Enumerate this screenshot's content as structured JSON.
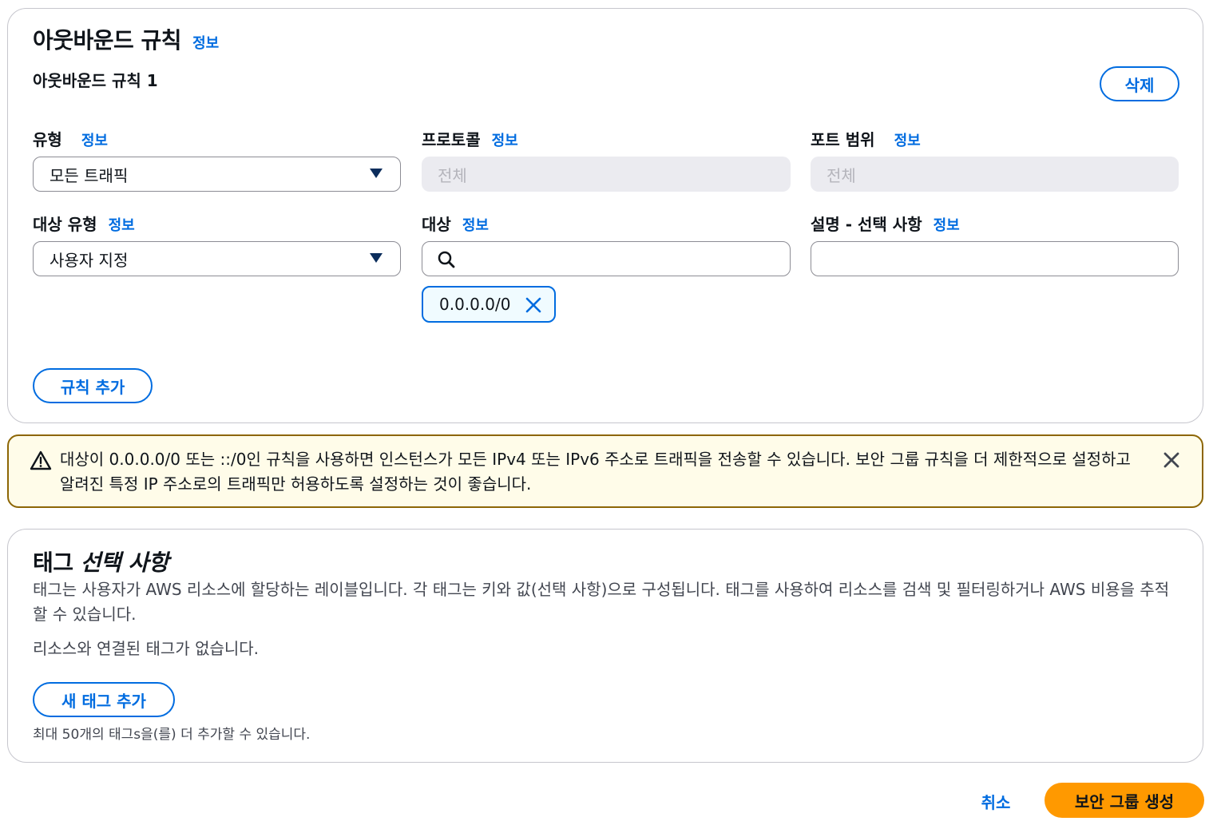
{
  "outbound": {
    "title": "아웃바운드 규칙",
    "info": "정보",
    "rule_title": "아웃바운드 규칙 1",
    "delete_label": "삭제",
    "type": {
      "label": "유형",
      "info": "정보",
      "value": "모든 트래픽"
    },
    "protocol": {
      "label": "프로토콜",
      "info": "정보",
      "value": "전체"
    },
    "port_range": {
      "label": "포트 범위",
      "info": "정보",
      "value": "전체"
    },
    "dest_type": {
      "label": "대상 유형",
      "info": "정보",
      "value": "사용자 지정"
    },
    "destination": {
      "label": "대상",
      "info": "정보",
      "value": "",
      "token": "0.0.0.0/0"
    },
    "description": {
      "label": "설명 - 선택 사항",
      "info": "정보",
      "value": ""
    },
    "add_rule_label": "규칙 추가"
  },
  "alert": {
    "text": "대상이 0.0.0.0/0 또는 ::/0인 규칙을 사용하면 인스턴스가 모든 IPv4 또는 IPv6 주소로 트래픽을 전송할 수 있습니다. 보안 그룹 규칙을 더 제한적으로 설정하고 알려진 특정 IP 주소로의 트래픽만 허용하도록 설정하는 것이 좋습니다.",
    "icon": "warning-icon"
  },
  "tags": {
    "title_plain": "태그",
    "title_italic": "선택 사항",
    "description": "태그는 사용자가 AWS 리소스에 할당하는 레이블입니다. 각 태그는 키와 값(선택 사항)으로 구성됩니다. 태그를 사용하여 리소스를 검색 및 필터링하거나 AWS 비용을 추적할 수 있습니다.",
    "empty": "리소스와 연결된 태그가 없습니다.",
    "add_label": "새 태그 추가",
    "limit_note": "최대 50개의 태그s을(를) 더 추가할 수 있습니다."
  },
  "footer": {
    "cancel_label": "취소",
    "create_label": "보안 그룹 생성"
  },
  "colors": {
    "link": "#006ce0",
    "primary": "#ff9900",
    "warning_border": "#8d6605",
    "warning_bg": "#fffce9"
  }
}
